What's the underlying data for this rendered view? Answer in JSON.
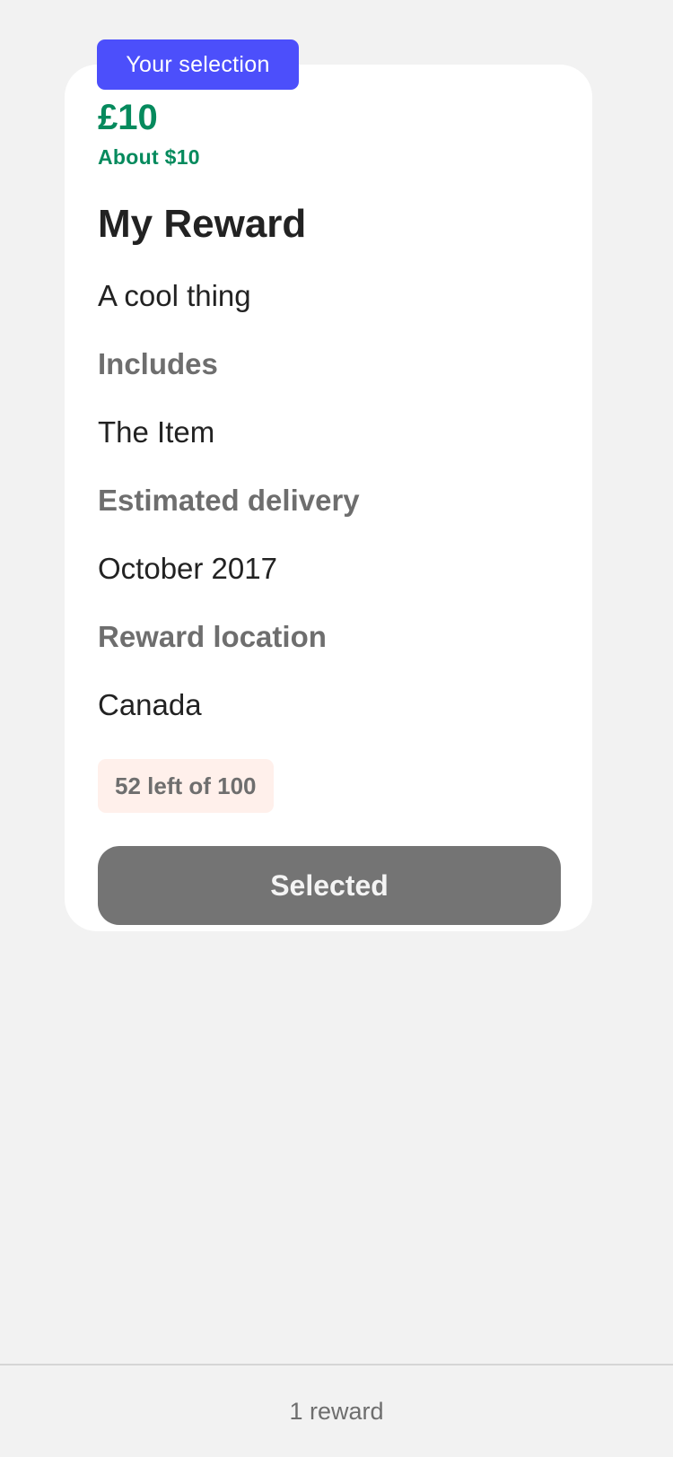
{
  "reward_card": {
    "selection_badge": "Your selection",
    "price": "£10",
    "converted_price": "About $10",
    "title": "My Reward",
    "description": "A cool thing",
    "includes": {
      "heading": "Includes",
      "value": "The Item"
    },
    "delivery": {
      "heading": "Estimated delivery",
      "value": "October 2017"
    },
    "location": {
      "heading": "Reward location",
      "value": "Canada"
    },
    "remaining": "52 left of 100",
    "button_label": "Selected"
  },
  "footer": {
    "text": "1 reward"
  },
  "colors": {
    "background": "#f2f2f2",
    "card": "#ffffff",
    "accent_badge": "#4c4ffb",
    "price_green": "#058a5d",
    "remaining_badge_bg": "#fff0eb",
    "button_disabled": "#747474"
  }
}
